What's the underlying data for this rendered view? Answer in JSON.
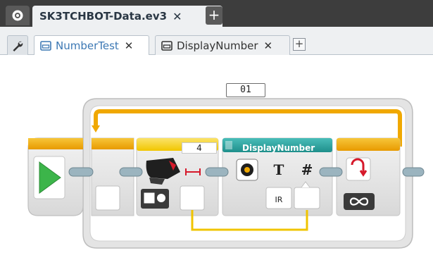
{
  "project": {
    "tab_label": "SK3TCHBOT-Data.ev3",
    "close_glyph": "✕",
    "add_glyph": "+"
  },
  "programs": {
    "tabs": [
      {
        "label": "NumberTest",
        "active": true,
        "close_glyph": "✕"
      },
      {
        "label": "DisplayNumber",
        "active": false,
        "close_glyph": "✕"
      }
    ],
    "add_glyph": "+"
  },
  "canvas": {
    "loop_name": "01",
    "infrared_block": {
      "mode_value": "4",
      "port_label": "IR"
    },
    "my_block": {
      "title": "DisplayNumber",
      "text_param_icon": "T",
      "number_param_icon": "#"
    },
    "loop_block": {
      "mode_icon": "infinity-icon"
    }
  },
  "colors": {
    "tab_bar_bg": "#3d3d3d",
    "program_bar_bg": "#eef0f2",
    "block_body": "#e6e6e6",
    "flow_orange": "#f0a800",
    "flow_yellow": "#f7d21e",
    "my_block_teal": "#2aa5a1",
    "start_green": "#3cb54a",
    "data_wire": "#f0c400"
  }
}
